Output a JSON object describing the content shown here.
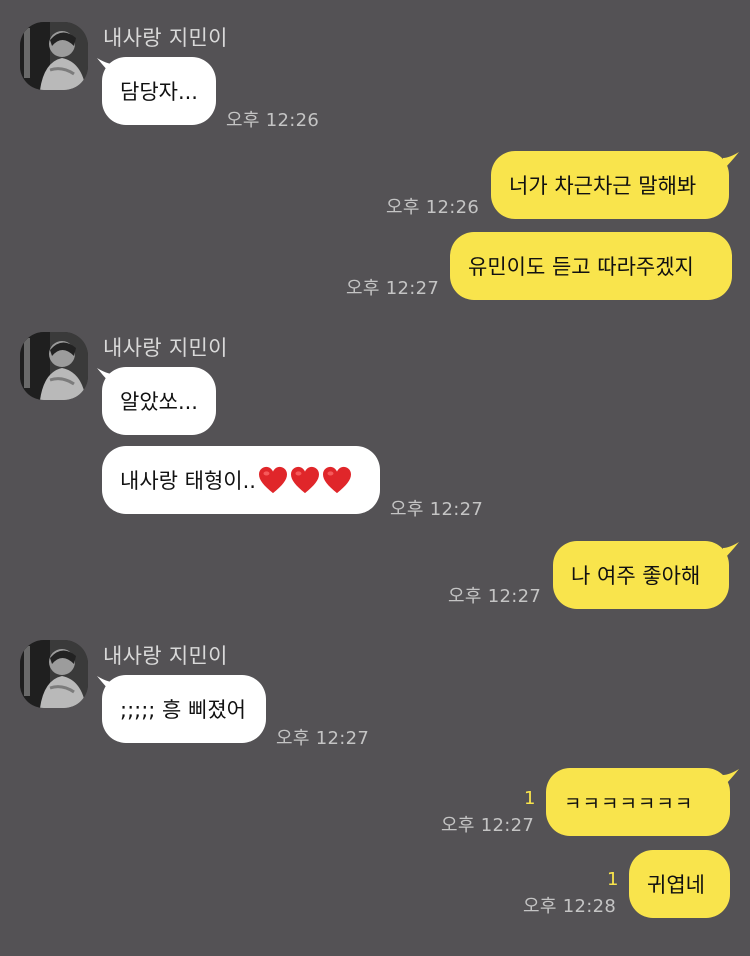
{
  "messages": [
    {
      "direction": "in",
      "sender": "내사랑 지민이",
      "text": "담당자...",
      "time": "오후 12:26"
    },
    {
      "direction": "out",
      "text": "너가 차근차근 말해봐",
      "time": "오후 12:26"
    },
    {
      "direction": "out",
      "text": "유민이도 듣고 따라주겠지",
      "time": "오후 12:27"
    },
    {
      "direction": "in",
      "sender": "내사랑 지민이",
      "text": "알았쏘...",
      "time": ""
    },
    {
      "direction": "in",
      "text": "내사랑 태형이..",
      "time": "오후 12:27",
      "icons": [
        "heart-icon",
        "heart-icon",
        "heart-icon"
      ]
    },
    {
      "direction": "out",
      "text": "나 여주 좋아해",
      "time": "오후 12:27"
    },
    {
      "direction": "in",
      "sender": "내사랑 지민이",
      "text": ";;;;; 흥 삐졌어",
      "time": "오후 12:27"
    },
    {
      "direction": "out",
      "text": "ㅋㅋㅋㅋㅋㅋㅋ",
      "time": "오후 12:27",
      "unread": "1"
    },
    {
      "direction": "out",
      "text": "귀엽네",
      "time": "오후 12:28",
      "unread": "1"
    }
  ],
  "colors": {
    "background": "#545255",
    "incoming_bubble": "#ffffff",
    "outgoing_bubble": "#f9e44c",
    "unread_count": "#f9e44c",
    "heart": "#e0262a"
  }
}
